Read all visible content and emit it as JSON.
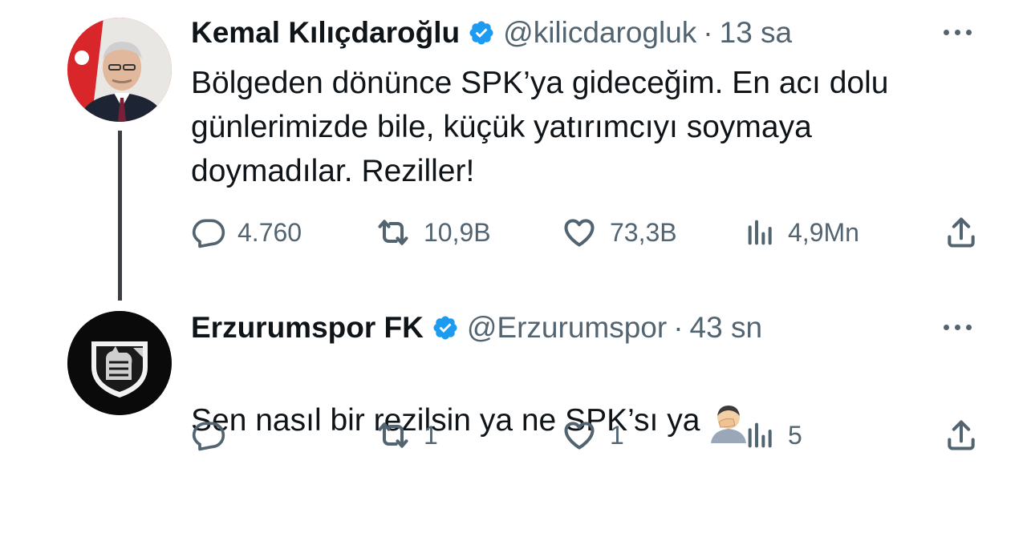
{
  "tweets": [
    {
      "name": "Kemal Kılıçdaroğlu",
      "handle": "@kilicdarogluk",
      "separator": "·",
      "time": "13 sa",
      "text": "Bölgeden dönünce SPK’ya gideceğim. En acı dolu\ngünlerimizde bile, küçük yatırımcıyı soymaya\ndoymadılar. Reziller!",
      "replies": "4.760",
      "retweets": "10,9B",
      "likes": "73,3B",
      "views": "4,9Mn",
      "avatar_icon": "person-portrait-icon",
      "verified_icon": "verified-badge-icon"
    },
    {
      "name": "Erzurumspor FK",
      "handle": "@Erzurumspor",
      "separator": "·",
      "time": "43 sn",
      "text": "Sen nasıl bir rezilsin ya ne SPK’sı ya",
      "replies": "",
      "retweets": "1",
      "likes": "1",
      "views": "5",
      "avatar_icon": "club-crest-icon",
      "verified_icon": "verified-badge-icon",
      "emoji_icon": "person-facepalm-emoji-icon"
    }
  ],
  "colors": {
    "verified": "#1d9bf0",
    "muted": "#536471",
    "text": "#0f1419"
  }
}
